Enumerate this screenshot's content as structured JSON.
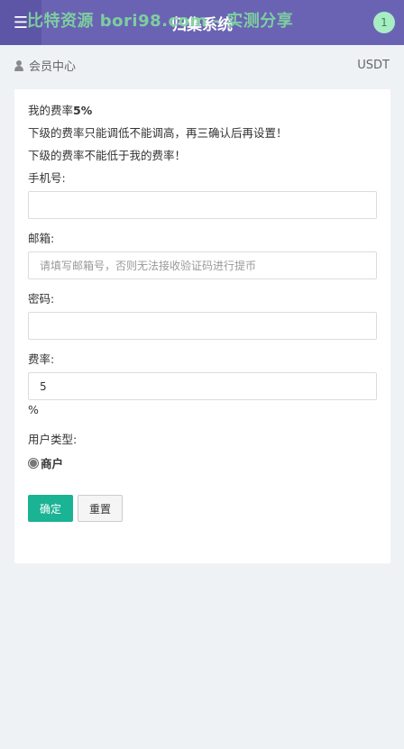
{
  "header": {
    "menu_icon": "hamburger-menu-icon",
    "title": "归集系统",
    "watermark": "比特资源 bori98.com - 实测分享",
    "badge_count": "1"
  },
  "subbar": {
    "user_icon": "user-icon",
    "section": "会员中心",
    "currency": "USDT"
  },
  "form": {
    "my_rate_label": "我的费率",
    "my_rate_value": "5%",
    "notice1": "下级的费率只能调低不能调高，再三确认后再设置！",
    "notice2": "下级的费率不能低于我的费率！",
    "phone_label": "手机号:",
    "phone_value": "",
    "email_label": "邮箱:",
    "email_placeholder": "请填写邮箱号，否则无法接收验证码进行提币",
    "password_label": "密码:",
    "password_value": "",
    "rate_label": "费率:",
    "rate_value": "5",
    "rate_unit": "%",
    "user_type_label": "用户类型:",
    "user_type_option": "商户",
    "confirm_label": "确定",
    "reset_label": "重置"
  },
  "colors": {
    "header_bg": "#6a63b4",
    "primary": "#1ab394",
    "page_bg": "#eff2f5"
  }
}
